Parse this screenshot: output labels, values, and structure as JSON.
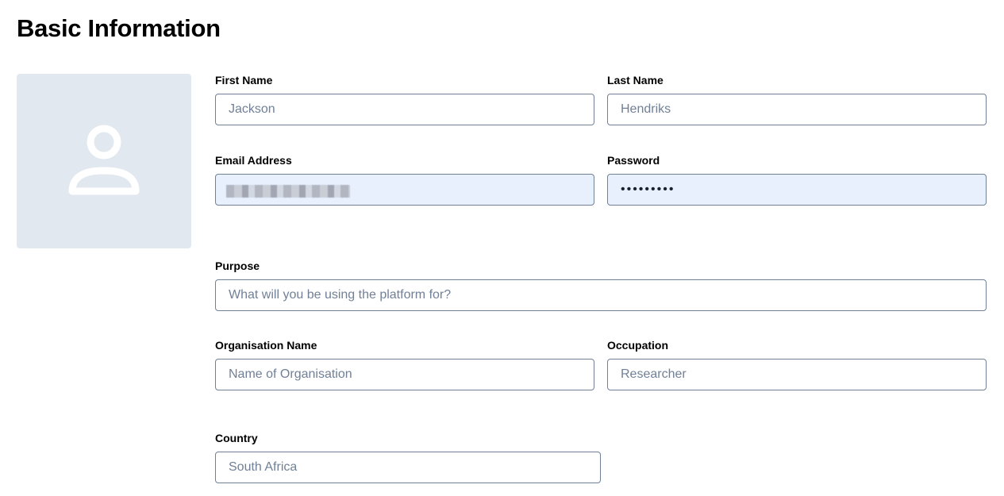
{
  "page": {
    "title": "Basic Information"
  },
  "avatar": {
    "icon": "user-icon"
  },
  "fields": {
    "first_name": {
      "label": "First Name",
      "placeholder": "Jackson"
    },
    "last_name": {
      "label": "Last Name",
      "placeholder": "Hendriks"
    },
    "email": {
      "label": "Email Address",
      "value": ""
    },
    "password": {
      "label": "Password",
      "value": "•••••••••"
    },
    "purpose": {
      "label": "Purpose",
      "placeholder": "What will you be using the platform for?"
    },
    "organisation": {
      "label": "Organisation Name",
      "placeholder": "Name of Organisation"
    },
    "occupation": {
      "label": "Occupation",
      "placeholder": "Researcher"
    },
    "country": {
      "label": "Country",
      "placeholder": "South Africa"
    }
  }
}
